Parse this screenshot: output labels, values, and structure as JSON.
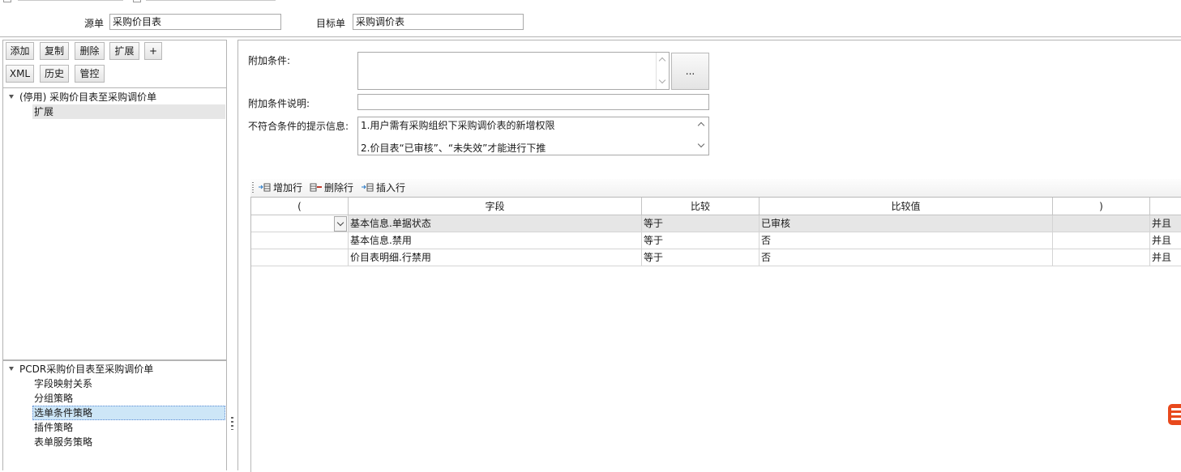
{
  "header": {
    "source_label": "源单",
    "source_value": "采购价目表",
    "target_label": "目标单",
    "target_value": "采购调价表"
  },
  "toolbar_left": {
    "add": "添加",
    "copy": "复制",
    "delete": "删除",
    "extend": "扩展",
    "plus": "+",
    "xml": "XML",
    "history": "历史",
    "control": "管控"
  },
  "tree_top": {
    "root": "(停用) 采购价目表至采购调价单",
    "child": "扩展"
  },
  "tree_bottom": {
    "root": "PCDR采购价目表至采购调价单",
    "items": [
      "字段映射关系",
      "分组策略",
      "选单条件策略",
      "插件策略",
      "表单服务策略"
    ]
  },
  "form": {
    "extra_condition_label": "附加条件:",
    "extra_condition_value": "",
    "ellipsis": "...",
    "extra_desc_label": "附加条件说明:",
    "extra_desc_value": "",
    "mismatch_label": "不符合条件的提示信息:",
    "mismatch_line1": "1.用户需有采购组织下采购调价表的新增权限",
    "mismatch_line2": "2.价目表“已审核”、“未失效”才能进行下推"
  },
  "grid_toolbar": {
    "add_row": "增加行",
    "delete_row": "删除行",
    "insert_row": "插入行"
  },
  "grid": {
    "columns": [
      "(",
      "字段",
      "比较",
      "比较值",
      ")",
      ""
    ],
    "rows": [
      {
        "lparen": "",
        "field": "基本信息.单据状态",
        "compare": "等于",
        "value": "已审核",
        "rparen": "",
        "logic": "并且"
      },
      {
        "lparen": "",
        "field": "基本信息.禁用",
        "compare": "等于",
        "value": "否",
        "rparen": "",
        "logic": "并且"
      },
      {
        "lparen": "",
        "field": "价目表明细.行禁用",
        "compare": "等于",
        "value": "否",
        "rparen": "",
        "logic": "并且"
      }
    ]
  },
  "colors": {
    "accent": "#cde6f7",
    "row_selected": "#e6e6e6",
    "logo": "#e8491d"
  }
}
